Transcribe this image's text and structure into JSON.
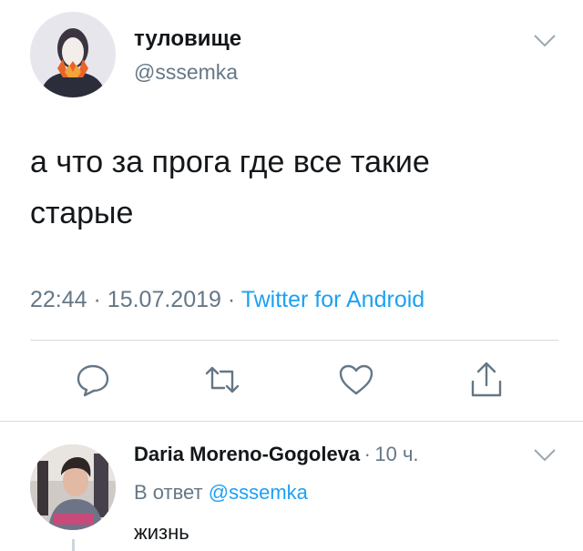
{
  "tweet": {
    "display_name": "туловище",
    "handle": "@sssemka",
    "text": "а что за прога где все такие старые",
    "time": "22:44",
    "date": "15.07.2019",
    "source": "Twitter for Android",
    "separator": "·"
  },
  "actions": [
    "reply-icon",
    "retweet-icon",
    "like-icon",
    "share-icon"
  ],
  "reply": {
    "display_name": "Daria Moreno-Gogoleva",
    "separator": "·",
    "time_ago": "10 ч.",
    "in_reply_prefix": "В ответ",
    "in_reply_handle": "@sssemka",
    "text": "жизнь"
  },
  "colors": {
    "accent": "#1da1f2",
    "secondary_text": "#657786",
    "divider": "#d6dce1"
  }
}
